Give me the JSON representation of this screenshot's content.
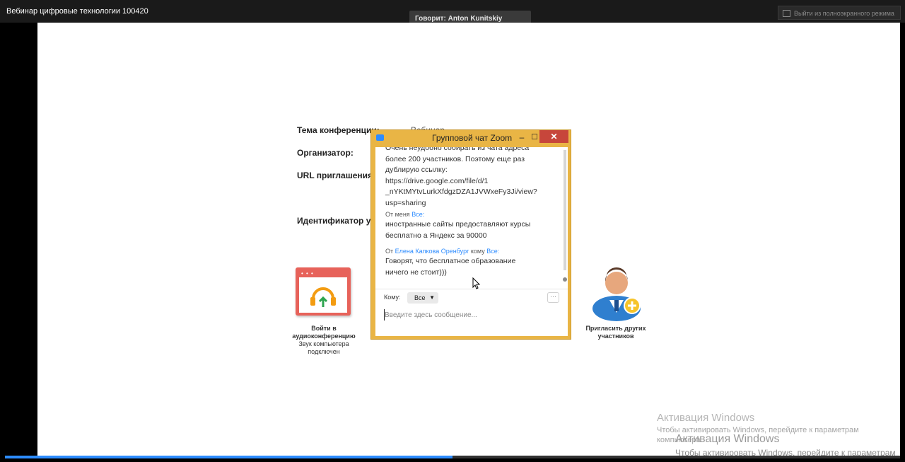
{
  "window": {
    "title": "Вебинар цифровые технологии 100420"
  },
  "speaker": {
    "label": "Говорит: Anton Kunitskiy"
  },
  "fullscreen": {
    "exit_label": "Выйти из полноэкранного режима"
  },
  "meeting_info": {
    "topic_label": "Тема конференции:",
    "topic_value": "Вебинар...",
    "organizer_label": "Организатор:",
    "url_label": "URL приглашения:",
    "id_label": "Идентификатор уч"
  },
  "audio": {
    "tile_dots": "• • •",
    "title_line1": "Войти в",
    "title_line2": "аудиоконференцию",
    "status_line1": "Звук компьютера",
    "status_line2": "подключен"
  },
  "invite": {
    "label_line1": "Пригласить других",
    "label_line2": "участников"
  },
  "chat": {
    "title": "Групповой чат Zoom",
    "minimize": "–",
    "maximize": "☐",
    "close": "✕",
    "messages": [
      {
        "lines": [
          "Очень неудобно собирать из чата адреса",
          "более 200 участников. Поэтому еще раз",
          "дублирую ссылку:",
          "https://drive.google.com/file/d/1",
          "_nYKtMYtvLurkXfdgzDZA1JVWxeFy3Ji/view?",
          "usp=sharing"
        ]
      },
      {
        "from_prefix": "От меня",
        "to": "Все:",
        "lines": [
          "иностранные сайты предоставляют курсы",
          "бесплатно а Яндекс за 90000"
        ]
      },
      {
        "from_prefix": "От",
        "from_name": "Елена Капкова Оренбург",
        "to_prefix": "кому",
        "to": "Все:",
        "lines": [
          "Говорят, что бесплатное образование",
          "ничего не стоит)))"
        ]
      }
    ],
    "to_label": "Кому:",
    "to_value": "Все",
    "more_button": "···",
    "input_placeholder": "Введите здесь сообщение..."
  },
  "activation": {
    "title": "Активация Windows",
    "text_line1": "Чтобы активировать Windows, перейдите к параметрам",
    "text_line2": "компьютера.",
    "title_ghost": "Активация Windows",
    "text_ghost": "Чтобы активировать Windows, перейдите к параметрам"
  },
  "playback": {
    "progress_fraction": 0.5
  },
  "colors": {
    "accent": "#2d8cff",
    "chat_frame": "#e9b545",
    "audio_tile": "#e7625a",
    "close_red": "#c7463b"
  }
}
